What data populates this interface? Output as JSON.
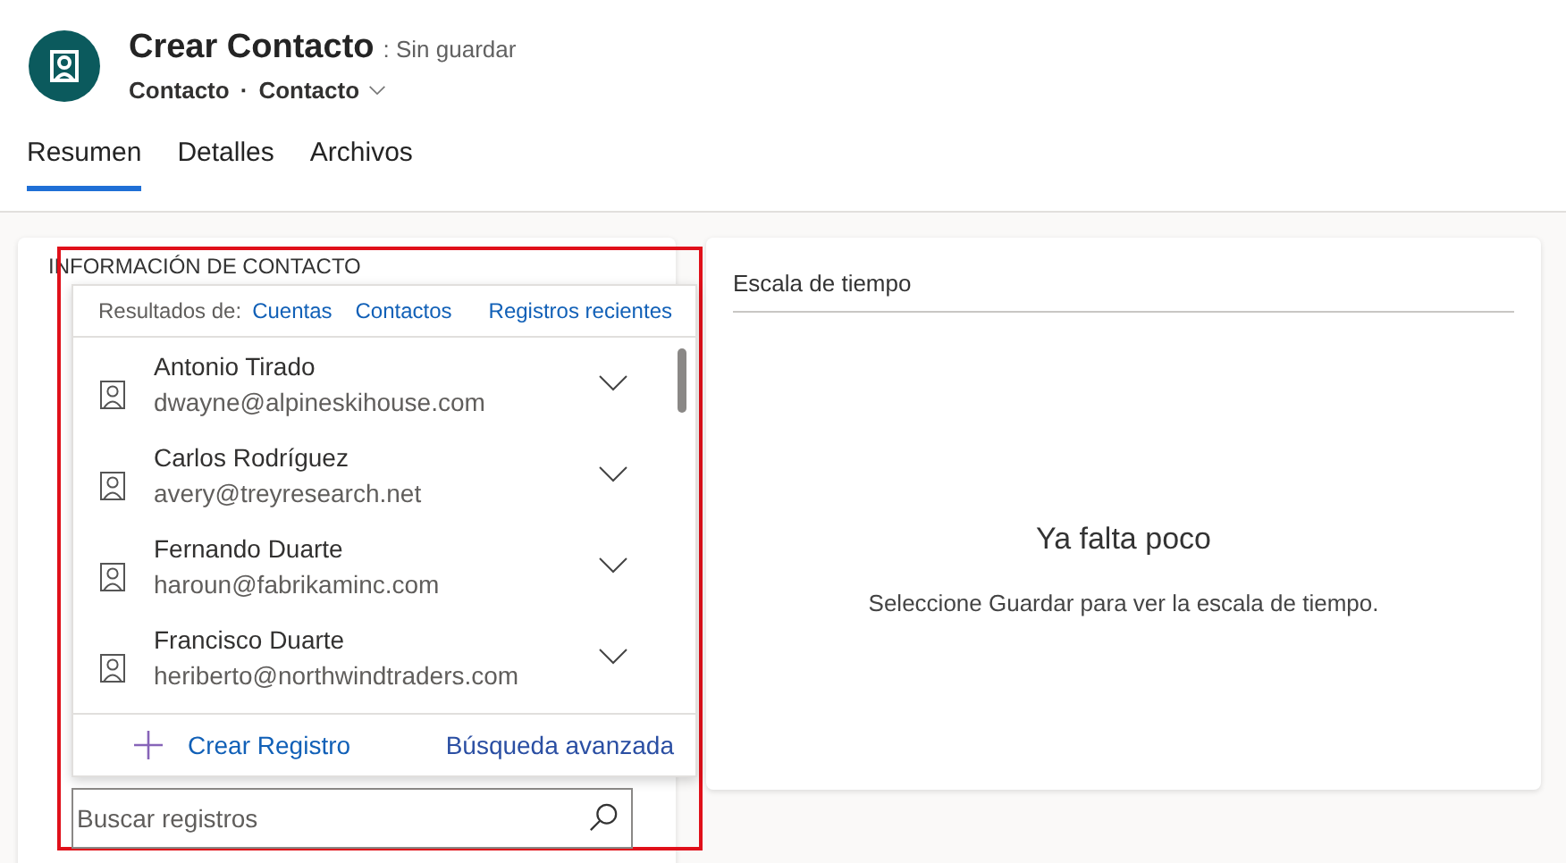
{
  "header": {
    "title": "Crear Contacto",
    "status": ": Sin guardar",
    "entity": "Contacto",
    "separator": "·",
    "form": "Contacto"
  },
  "tabs": [
    {
      "label": "Resumen",
      "selected": true
    },
    {
      "label": "Detalles",
      "selected": false
    },
    {
      "label": "Archivos",
      "selected": false
    }
  ],
  "contact_section": {
    "heading": "INFORMACIÓN DE CONTACTO"
  },
  "lookup": {
    "results_label": "Resultados de:",
    "filters": [
      "Cuentas",
      "Contactos"
    ],
    "recent": "Registros recientes",
    "results": [
      {
        "name": "Antonio Tirado",
        "email": "dwayne@alpineskihouse.com"
      },
      {
        "name": "Carlos Rodríguez",
        "email": "avery@treyresearch.net"
      },
      {
        "name": "Fernando Duarte",
        "email": "haroun@fabrikaminc.com"
      },
      {
        "name": "Francisco Duarte",
        "email": "heriberto@northwindtraders.com"
      }
    ],
    "new_record": "Crear Registro",
    "advanced_search": "Búsqueda avanzada",
    "search_placeholder": "Buscar registros"
  },
  "timeline": {
    "title": "Escala de tiempo",
    "empty_title": "Ya falta poco",
    "empty_text": "Seleccione Guardar para ver la escala de tiempo."
  }
}
